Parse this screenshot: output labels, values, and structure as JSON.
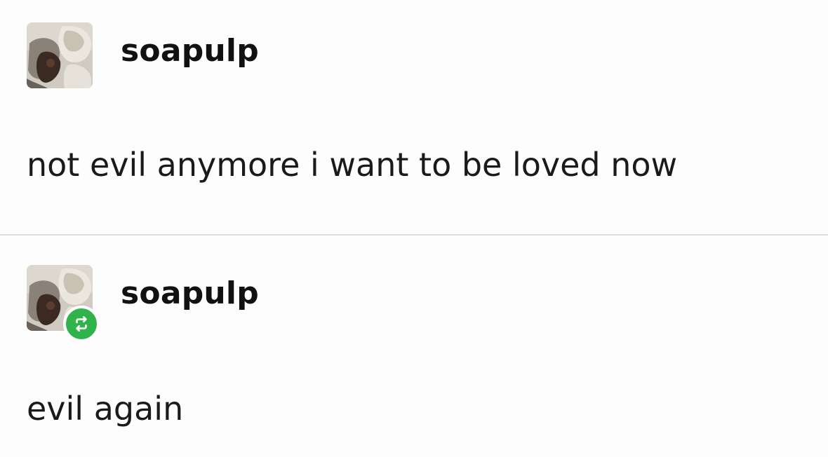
{
  "posts": [
    {
      "username": "soapulp",
      "text": "not evil anymore i want to be loved now",
      "reblog": false
    },
    {
      "username": "soapulp",
      "text": "evil again",
      "reblog": true
    }
  ],
  "colors": {
    "reblog_badge": "#2fb34a",
    "divider": "#dcdcdc",
    "text": "#111111"
  },
  "icons": {
    "reblog": "reblog-icon",
    "avatar": "avatar-image"
  }
}
